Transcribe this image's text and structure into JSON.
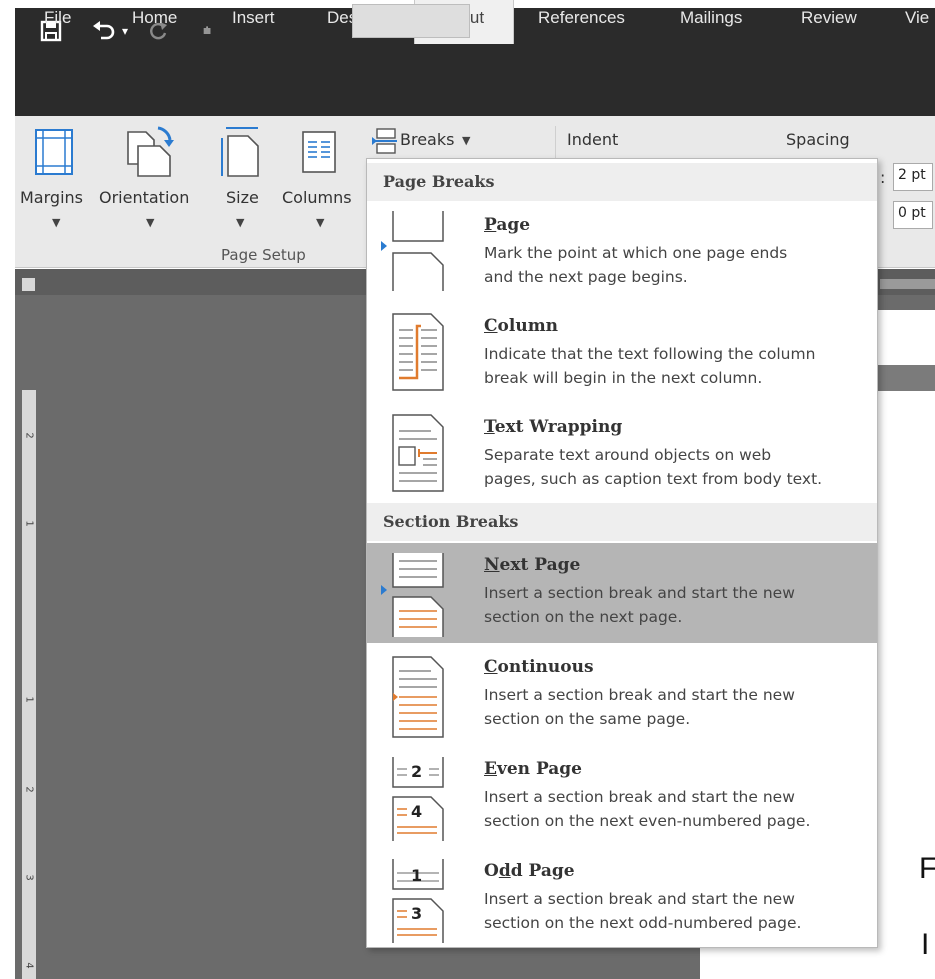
{
  "tabs": [
    "File",
    "Home",
    "Insert",
    "Design",
    "Layout",
    "References",
    "Mailings",
    "Review",
    "Vie"
  ],
  "active_tab": "Layout",
  "ribbon": {
    "margins": "Margins",
    "orientation": "Orientation",
    "size": "Size",
    "columns": "Columns",
    "breaks": "Breaks",
    "indent": "Indent",
    "spacing": "Spacing",
    "group_page_setup": "Page Setup",
    "spacing_before": "2 pt",
    "spacing_after": "0 pt"
  },
  "dropdown": {
    "page_breaks_header": "Page Breaks",
    "section_breaks_header": "Section Breaks",
    "items": [
      {
        "title": "Page",
        "accel": "P",
        "rest": "age",
        "desc": "Mark the point at which one page ends\nand the next page begins."
      },
      {
        "title": "Column",
        "accel": "C",
        "rest": "olumn",
        "desc": "Indicate that the text following the column\nbreak will begin in the next column."
      },
      {
        "title": "Text Wrapping",
        "accel": "T",
        "rest": "ext Wrapping",
        "desc": "Separate text around objects on web\npages, such as caption text from body text."
      },
      {
        "title": "Next Page",
        "accel": "N",
        "rest": "ext Page",
        "desc": "Insert a section break and start the new\nsection on the next page."
      },
      {
        "title": "Continuous",
        "accel": "C",
        "rest": "ontinuous",
        "desc": "Insert a section break and start the new\nsection on the same page."
      },
      {
        "title": "Even Page",
        "accel": "E",
        "rest": "ven Page",
        "desc": "Insert a section break and start the new\nsection on the next even-numbered page."
      },
      {
        "title": "Odd Page",
        "pre": "O",
        "accel": "d",
        "rest": "d Page",
        "desc": "Insert a section break and start the new\nsection on the next odd-numbered page."
      }
    ]
  },
  "icons": {
    "even_top": "2",
    "even_bottom": "4",
    "odd_top": "1",
    "odd_bottom": "3"
  },
  "ruler_numbers": [
    "2",
    "1",
    "1",
    "2",
    "3",
    "4"
  ],
  "doc_letters": [
    "F",
    "I"
  ],
  "colors": {
    "titlebar": "#2b2b2b",
    "ribbon": "#e9e9e9",
    "selected_item": "#b5b5b5",
    "accent_orange": "#e07b2e",
    "accent_blue": "#2b7bd0"
  }
}
